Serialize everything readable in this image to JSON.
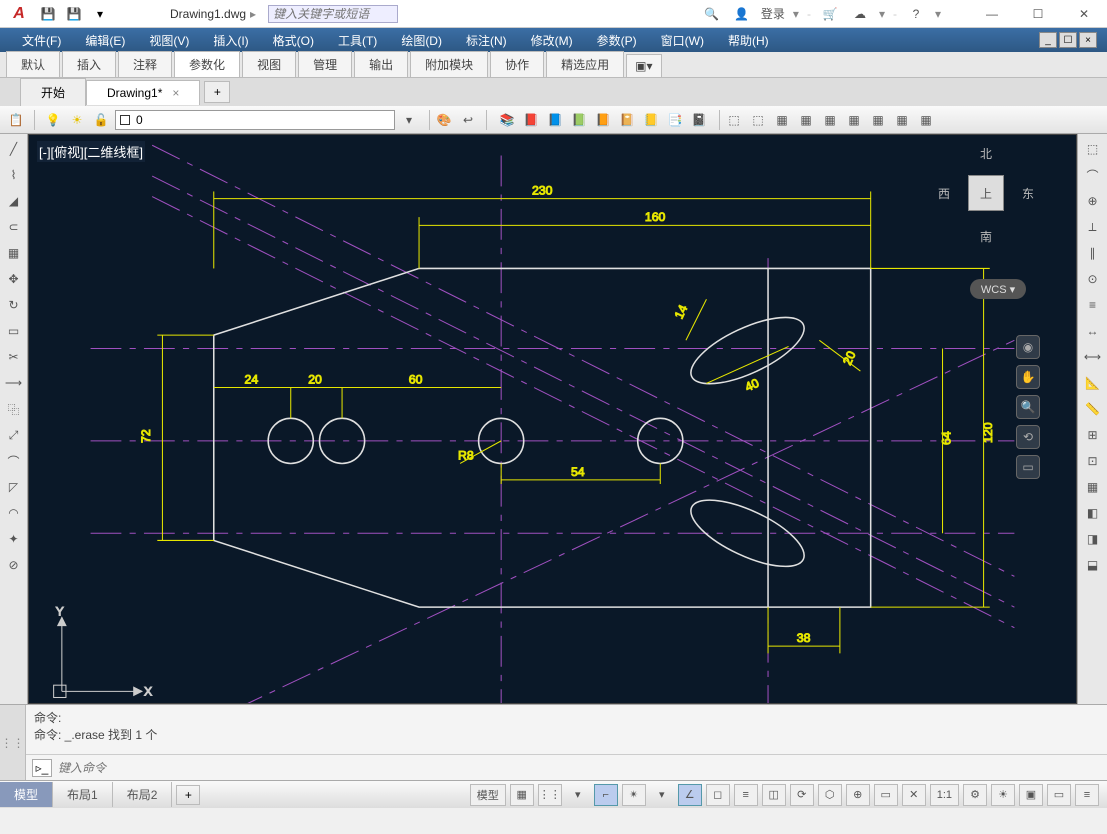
{
  "title": {
    "filename": "Drawing1.dwg",
    "search_placeholder": "键入关键字或短语",
    "login": "登录"
  },
  "menus": [
    "文件(F)",
    "编辑(E)",
    "视图(V)",
    "插入(I)",
    "格式(O)",
    "工具(T)",
    "绘图(D)",
    "标注(N)",
    "修改(M)",
    "参数(P)",
    "窗口(W)",
    "帮助(H)"
  ],
  "ribbon_tabs": [
    "默认",
    "插入",
    "注释",
    "参数化",
    "视图",
    "管理",
    "输出",
    "附加模块",
    "协作",
    "精选应用"
  ],
  "ribbon_active": "参数化",
  "file_tabs": {
    "start": "开始",
    "active": "Drawing1*"
  },
  "layer": {
    "current": "0"
  },
  "viewport_label": "[-][俯视][二维线框]",
  "viewcube": {
    "n": "北",
    "s": "南",
    "e": "东",
    "w": "西",
    "top": "上"
  },
  "wcs": "WCS ▾",
  "dimensions": {
    "d230": "230",
    "d160": "160",
    "d14": "14",
    "d20b": "20",
    "d40": "40",
    "d24": "24",
    "d20": "20",
    "d60": "60",
    "d72": "72",
    "r8": "R8",
    "d54": "54",
    "d38": "38",
    "d64": "64",
    "d120": "120"
  },
  "axes": {
    "x": "X",
    "y": "Y"
  },
  "cmd": {
    "line1": "命令:",
    "line2": "命令: _.erase 找到 1 个",
    "placeholder": "键入命令"
  },
  "layouts": [
    "模型",
    "布局1",
    "布局2"
  ],
  "status": {
    "model": "模型",
    "scale": "1:1"
  }
}
